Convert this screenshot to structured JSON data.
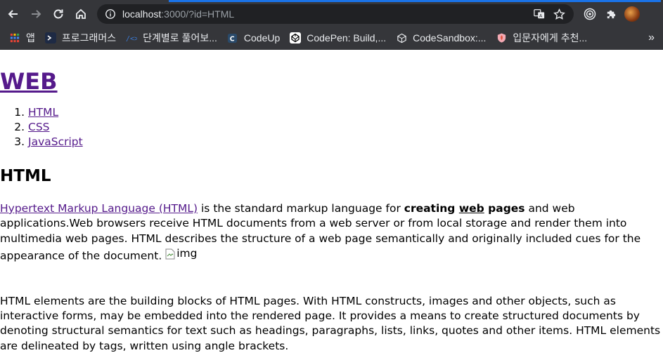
{
  "browser": {
    "url_host": "localhost",
    "url_rest": ":3000/?id=HTML",
    "bookmarks": [
      {
        "label": "앱",
        "icon": "apps-grid-icon"
      },
      {
        "label": "프로그래머스",
        "icon": "programmers-icon"
      },
      {
        "label": "단계별로 풀어보...",
        "icon": "code-brackets-icon"
      },
      {
        "label": "CodeUp",
        "icon": "codeup-icon"
      },
      {
        "label": "CodePen: Build,...",
        "icon": "codepen-icon"
      },
      {
        "label": "CodeSandbox:...",
        "icon": "codesandbox-icon"
      },
      {
        "label": "입문자에게 추천...",
        "icon": "shield-icon"
      }
    ],
    "more_label": "»"
  },
  "page": {
    "site_title": "WEB",
    "nav": [
      "HTML",
      "CSS",
      "JavaScript"
    ],
    "heading": "HTML",
    "p1": {
      "link": "Hypertext Markup Language (HTML)",
      "t1": " is the standard markup language for ",
      "b1": "creating ",
      "b_underline": "web",
      "b2": " pages",
      "t2": " and web applications.Web browsers receive HTML documents from a web server or from local storage and render them into multimedia web pages. HTML describes the structure of a web page semantically and originally included cues for the appearance of the document. ",
      "img_alt": "img"
    },
    "p2": "HTML elements are the building blocks of HTML pages. With HTML constructs, images and other objects, such as interactive forms, may be embedded into the rendered page. It provides a means to create structured documents by denoting structural semantics for text such as headings, paragraphs, lists, links, quotes and other items. HTML elements are delineated by tags, written using angle brackets."
  }
}
